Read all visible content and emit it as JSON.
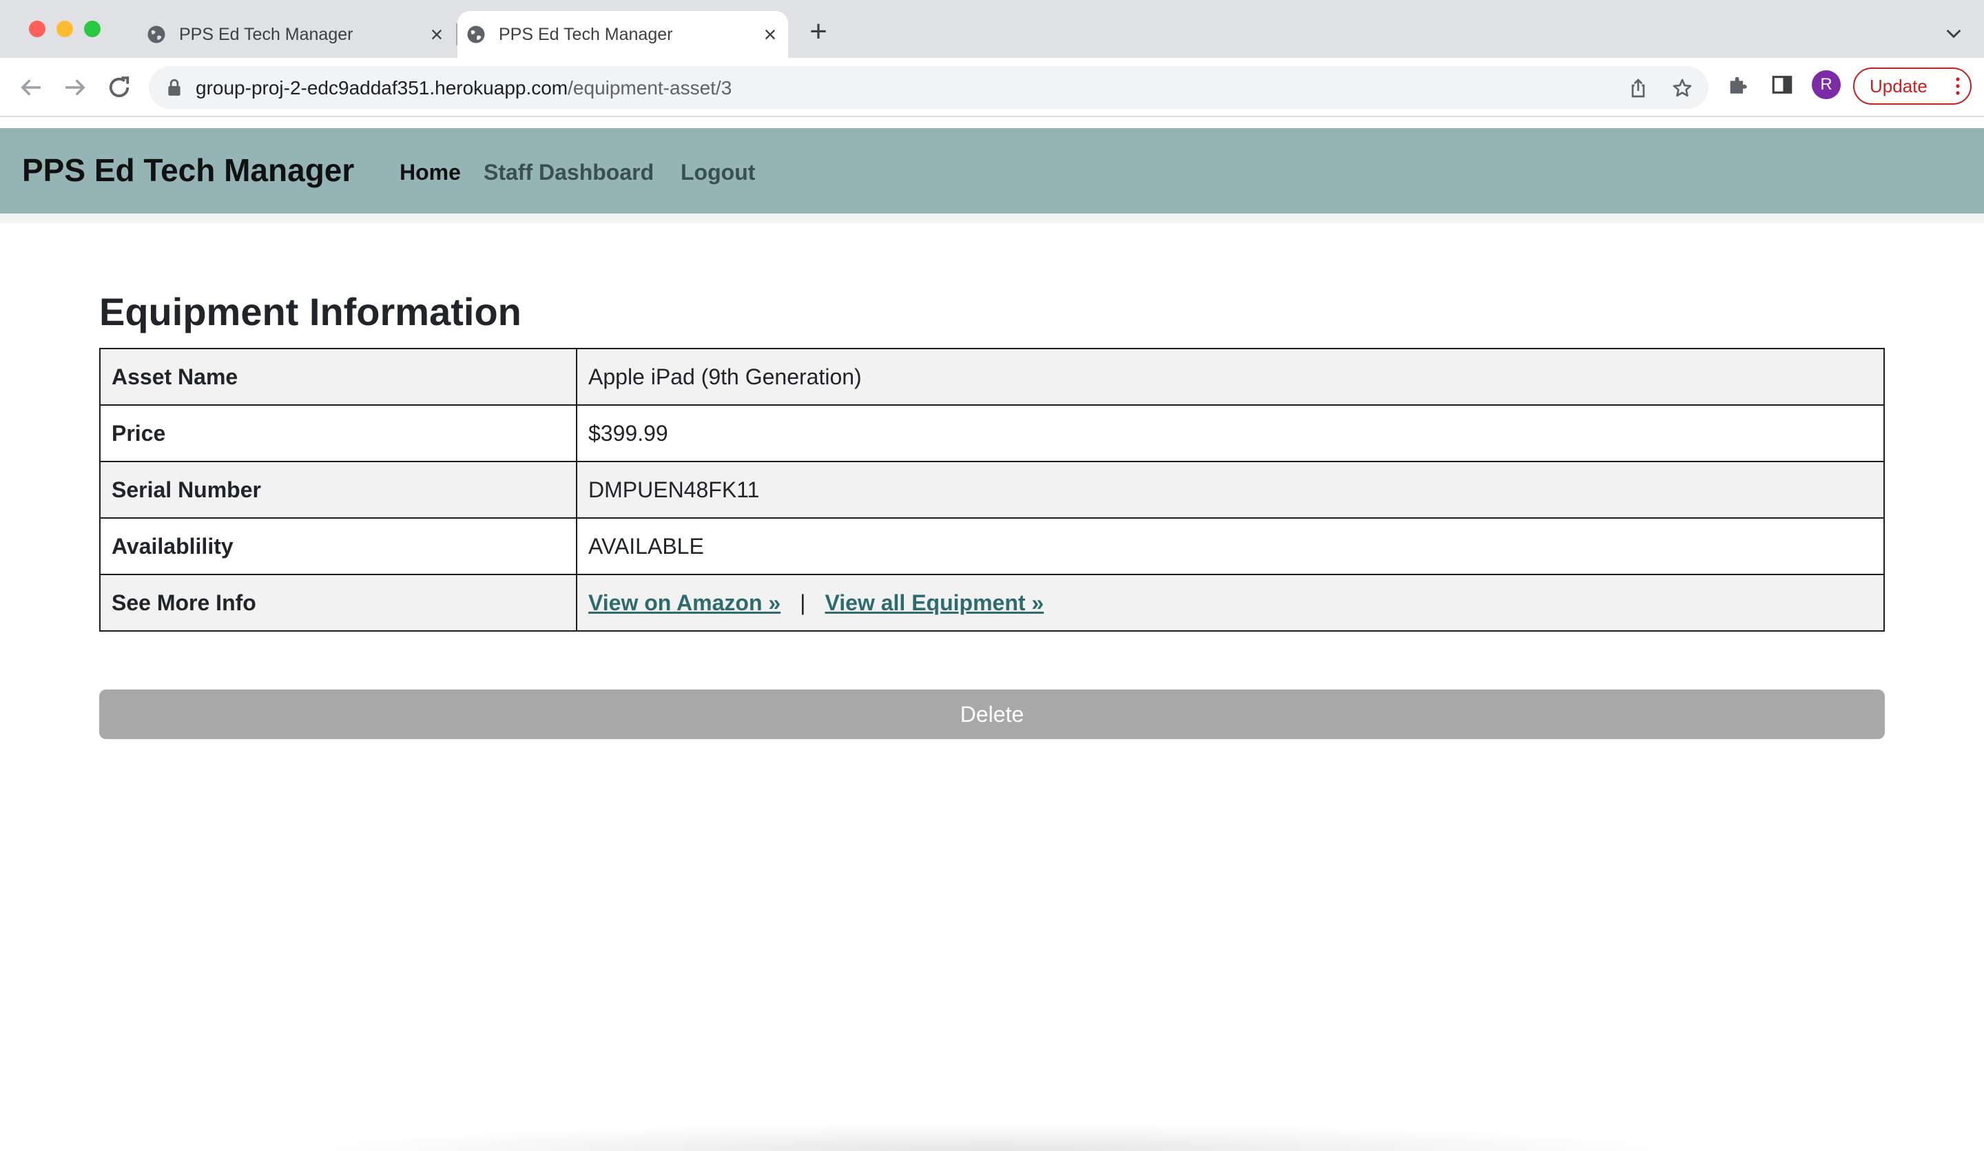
{
  "browser": {
    "tabs": [
      {
        "title": "PPS Ed Tech Manager",
        "close": "×"
      },
      {
        "title": "PPS Ed Tech Manager",
        "close": "×"
      }
    ],
    "new_tab": "+",
    "url_host": "group-proj-2-edc9addaf351.herokuapp.com",
    "url_path": "/equipment-asset/3",
    "profile_initial": "R",
    "update_label": "Update"
  },
  "navbar": {
    "brand": "PPS Ed Tech Manager",
    "links": [
      "Home",
      "Staff Dashboard",
      "Logout"
    ]
  },
  "main": {
    "title": "Equipment Information",
    "rows": [
      {
        "label": "Asset Name",
        "value": "Apple iPad (9th Generation)"
      },
      {
        "label": "Price",
        "value": "$399.99"
      },
      {
        "label": "Serial Number",
        "value": "DMPUEN48FK11"
      },
      {
        "label": "Availablility",
        "value": "AVAILABLE"
      },
      {
        "label": "See More Info"
      }
    ],
    "more_info": {
      "amazon_link": "View on Amazon »",
      "separator": "|",
      "all_link": "View all Equipment »"
    },
    "delete_label": "Delete"
  },
  "colors": {
    "navbar_bg": "#94b4b6",
    "link": "#2d6b6e",
    "delete_bg": "#a8a8a8"
  }
}
